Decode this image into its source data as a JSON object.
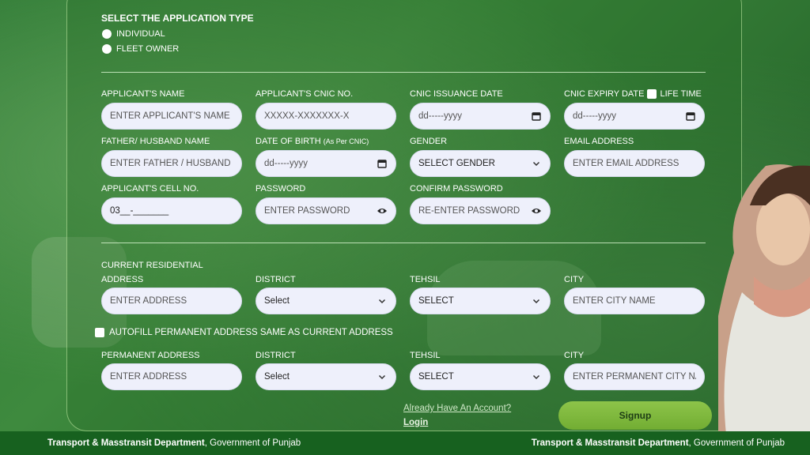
{
  "app_type": {
    "title": "SELECT THE APPLICATION TYPE",
    "options": [
      "INDIVIDUAL",
      "FLEET OWNER"
    ]
  },
  "personal": {
    "name_label": "APPLICANT'S NAME",
    "name_placeholder": "ENTER APPLICANT'S NAME",
    "cnic_label": "APPLICANT'S CNIC NO.",
    "cnic_placeholder": "XXXXX-XXXXXXX-X",
    "issuance_label": "CNIC ISSUANCE DATE",
    "issuance_value": "dd-----yyyy",
    "expiry_label": "CNIC EXPIRY DATE",
    "lifetime_label": "LIFE TIME",
    "expiry_value": "dd-----yyyy",
    "father_label": "FATHER/ HUSBAND NAME",
    "father_placeholder": "ENTER FATHER / HUSBAND N.",
    "dob_label": "DATE OF BIRTH",
    "dob_note": "(As Per CNIC)",
    "dob_value": "dd-----yyyy",
    "gender_label": "GENDER",
    "gender_value": "SELECT GENDER",
    "email_label": "EMAIL ADDRESS",
    "email_placeholder": "ENTER EMAIL ADDRESS",
    "cell_label": "APPLICANT'S CELL NO.",
    "cell_value": "03__-_______",
    "password_label": "PASSWORD",
    "password_placeholder": "ENTER PASSWORD",
    "confirm_label": "CONFIRM PASSWORD",
    "confirm_placeholder": "RE-ENTER PASSWORD"
  },
  "current_address": {
    "address_label_line1": "CURRENT RESIDENTIAL",
    "address_label_line2": "ADDRESS",
    "address_placeholder": "ENTER ADDRESS",
    "district_label": "DISTRICT",
    "district_value": "Select",
    "tehsil_label": "TEHSIL",
    "tehsil_value": "SELECT",
    "city_label": "CITY",
    "city_placeholder": "ENTER CITY NAME"
  },
  "autofill_label": "AUTOFILL PERMANENT ADDRESS SAME AS CURRENT ADDRESS",
  "permanent_address": {
    "address_label": "PERMANENT ADDRESS",
    "address_placeholder": "ENTER ADDRESS",
    "district_label": "DISTRICT",
    "district_value": "Select",
    "tehsil_label": "TEHSIL",
    "tehsil_value": "SELECT",
    "city_label": "CITY",
    "city_placeholder": "ENTER PERMANENT CITY NAN"
  },
  "actions": {
    "have_account": "Already Have An Account?",
    "login": "Login",
    "signup": "Signup"
  },
  "footer": {
    "dept": "Transport & Masstransit Department",
    "gov": ", Government of Punjab"
  }
}
